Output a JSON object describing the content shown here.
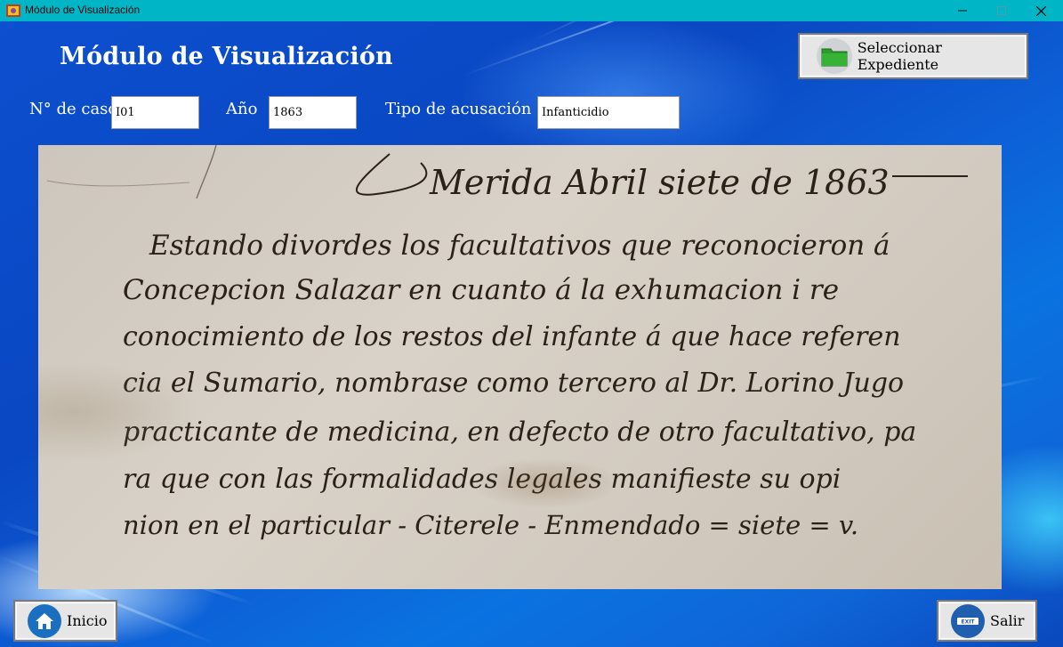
{
  "window": {
    "title": "Módulo de Visualización"
  },
  "header": {
    "title": "Módulo de Visualización",
    "select_button": "Seleccionar Expediente"
  },
  "fields": {
    "caso_label": "N° de caso",
    "caso_value": "I01",
    "anio_label": "Año",
    "anio_value": "1863",
    "tipo_label": "Tipo de acusación",
    "tipo_value": "Infanticidio"
  },
  "document": {
    "lines": [
      "Merida Abril siete de 1863",
      "Estando divordes los facultativos que reconocieron á",
      "Concepcion Salazar en cuanto á la exhumacion i re",
      "conocimiento de los restos del infante á que hace referen",
      "cia el Sumario, nombrase como tercero al Dr. Lorino Jugo",
      "practicante de medicina, en defecto de otro facultativo, pa",
      "ra que con las formalidades legales manifieste su opi",
      "nion en el particular - Citerele - Enmendado = siete = v."
    ]
  },
  "footer": {
    "inicio_label": "Inicio",
    "salir_label": "Salir",
    "exit_icon_text": "EXIT"
  },
  "colors": {
    "titlebar": "#00b6c6",
    "background": "#0a4fcf",
    "folder": "#2c9a2c",
    "home_icon": "#1b6fc0"
  }
}
